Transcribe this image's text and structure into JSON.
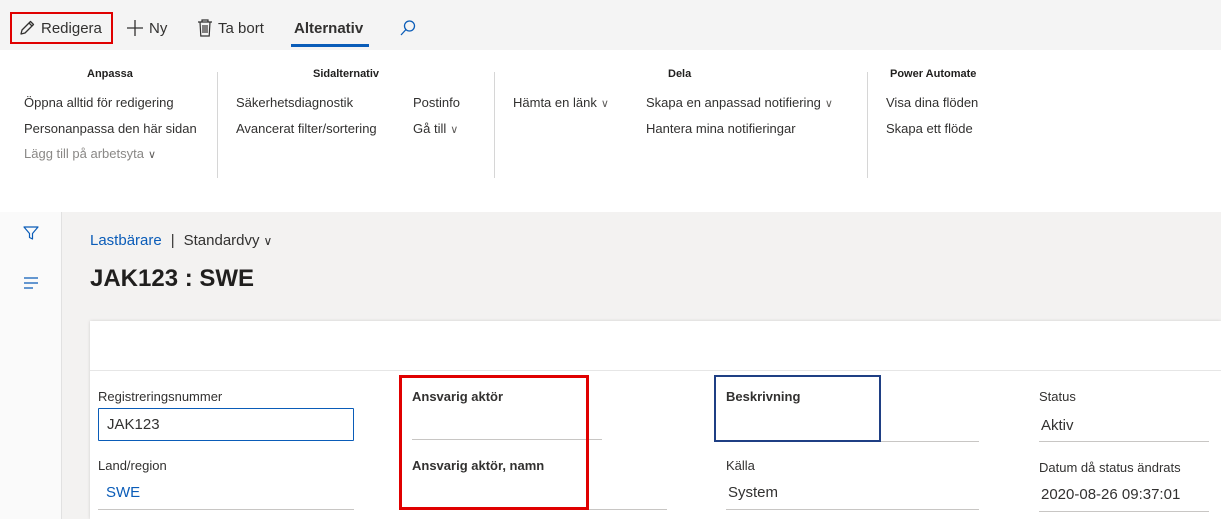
{
  "toolbar": {
    "edit_label": "Redigera",
    "new_label": "Ny",
    "delete_label": "Ta bort",
    "options_tab_label": "Alternativ",
    "icons": {
      "edit": "pencil-icon",
      "new": "plus-icon",
      "delete": "trash-icon",
      "search": "search-icon"
    }
  },
  "ribbon": {
    "groups": [
      {
        "title": "Anpassa",
        "items": [
          "Öppna alltid för redigering",
          "Personanpassa den här sidan",
          "Lägg till på arbetsyta"
        ]
      },
      {
        "title": "Sidalternativ",
        "items": [
          "Säkerhetsdiagnostik",
          "Avancerat filter/sortering",
          "Postinfo",
          "Gå till"
        ]
      },
      {
        "title": "Dela",
        "items": [
          "Hämta en länk",
          "Skapa en anpassad notifiering",
          "Hantera mina notifieringar"
        ]
      },
      {
        "title": "Power Automate",
        "items": [
          "Visa dina flöden",
          "Skapa ett flöde"
        ]
      }
    ]
  },
  "sidebar": {
    "icons": [
      "filter-icon",
      "list-icon"
    ]
  },
  "breadcrumb": {
    "link": "Lastbärare",
    "separator": "|",
    "view": "Standardvy"
  },
  "page": {
    "title": "JAK123 : SWE"
  },
  "form": {
    "registration_number": {
      "label": "Registreringsnummer",
      "value": "JAK123"
    },
    "country_region": {
      "label": "Land/region",
      "value": "SWE"
    },
    "responsible_actor": {
      "label": "Ansvarig aktör",
      "value": ""
    },
    "responsible_actor_name": {
      "label": "Ansvarig aktör, namn",
      "value": ""
    },
    "description": {
      "label": "Beskrivning",
      "value": ""
    },
    "source": {
      "label": "Källa",
      "value": "System"
    },
    "status": {
      "label": "Status",
      "value": "Aktiv"
    },
    "status_changed_date": {
      "label": "Datum då status ändrats",
      "value": "2020-08-26 09:37:01"
    }
  },
  "colors": {
    "accent": "#0a5cb8",
    "highlight_red": "#e00000",
    "highlight_blue": "#1f3f84",
    "page_background": "#f3f2f1"
  }
}
